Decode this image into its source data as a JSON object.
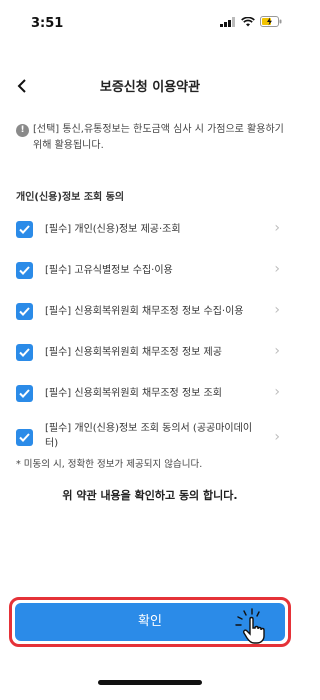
{
  "status_bar": {
    "time": "3:51"
  },
  "header": {
    "back_icon": "chevron-left-icon",
    "title": "보증신청 이용약관"
  },
  "notice": {
    "icon": "exclamation-icon",
    "text": "[선택] 통신,유통정보는 한도금액 심사 시 가점으로 활용하기 위해 활용됩니다."
  },
  "section": {
    "title": "개인(신용)정보 조회 동의"
  },
  "terms": [
    {
      "label": "[필수] 개인(신용)정보 제공·조회",
      "checked": true
    },
    {
      "label": "[필수] 고유식별정보 수집·이용",
      "checked": true
    },
    {
      "label": "[필수] 신용회복위원회 채무조정 정보 수집·이용",
      "checked": true
    },
    {
      "label": "[필수] 신용회복위원회 채무조정 정보 제공",
      "checked": true
    },
    {
      "label": "[필수] 신용회복위원회 채무조정 정보 조회",
      "checked": true
    },
    {
      "label": "[필수] 개인(신용)정보 조회 동의서 (공공마이데이터)",
      "checked": true
    }
  ],
  "footnote": "* 미동의 시, 정확한 정보가 제공되지 않습니다.",
  "confirm_text": "위 약관 내용을 확인하고 동의 합니다.",
  "confirm_button": {
    "label": "확인"
  },
  "colors": {
    "accent": "#2b8be8",
    "highlight": "#e53238"
  }
}
